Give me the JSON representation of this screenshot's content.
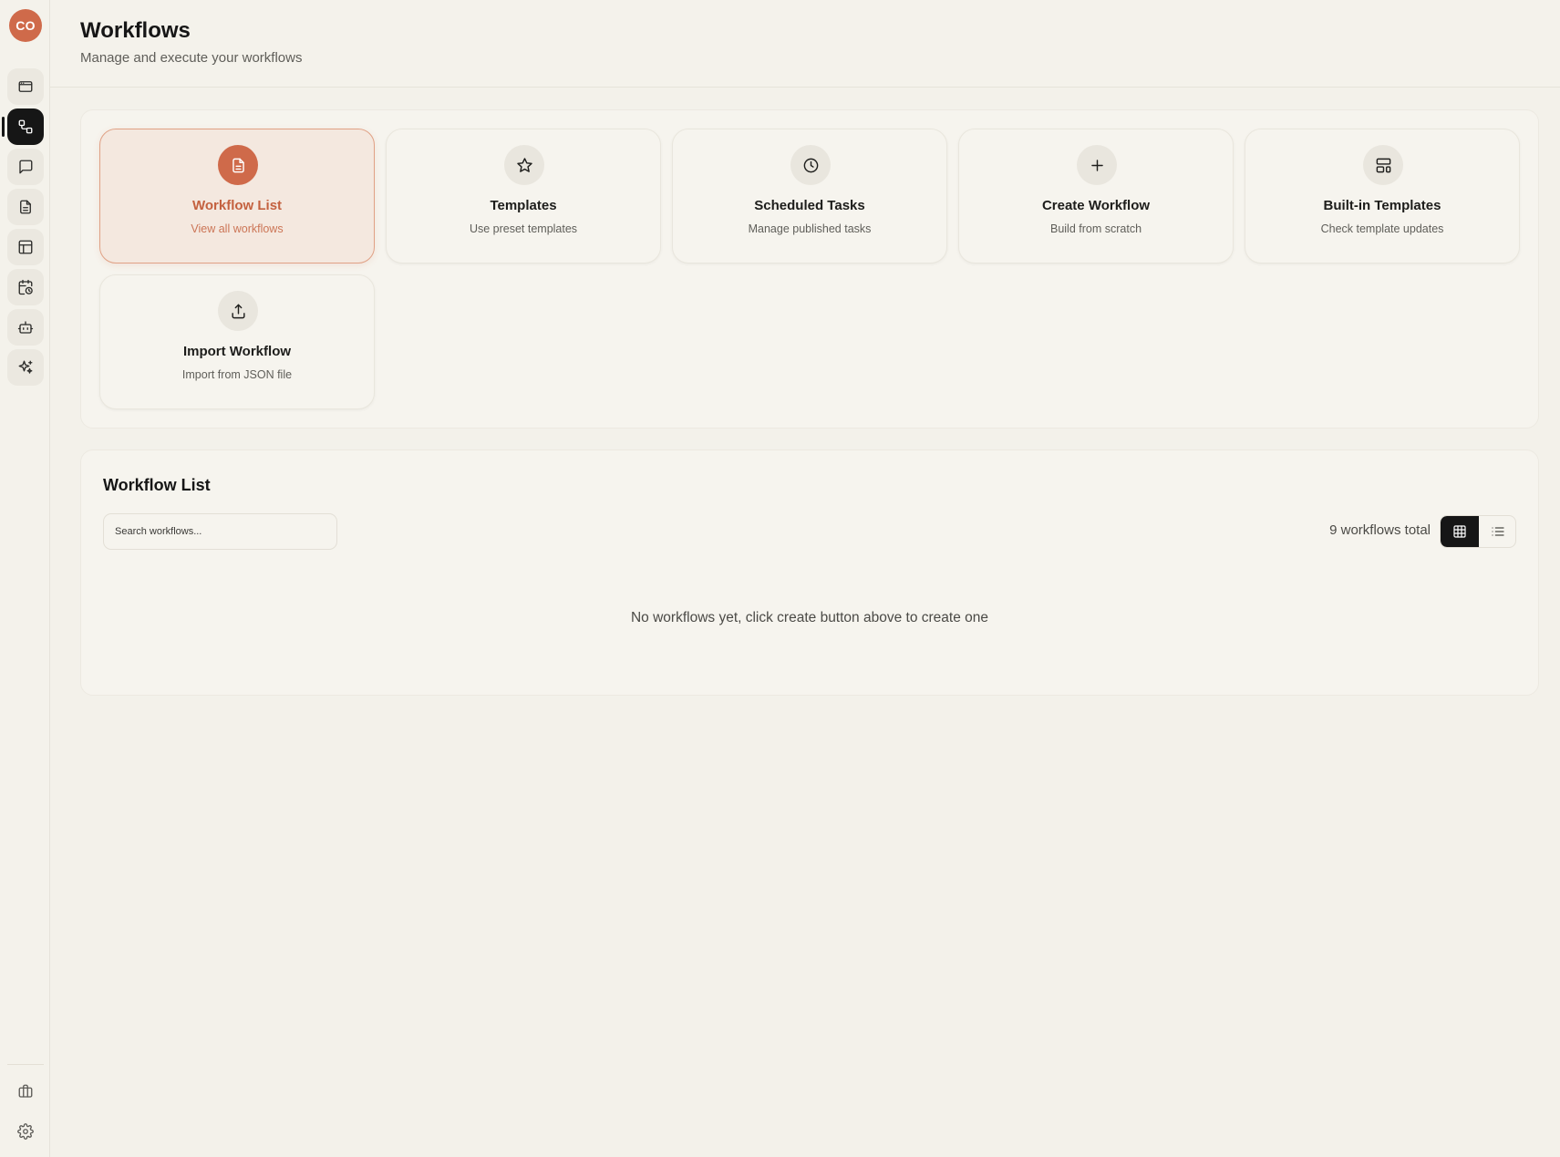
{
  "user": {
    "initials": "CO"
  },
  "sidebar": {
    "items": [
      {
        "icon": "browser-window-icon",
        "active": false
      },
      {
        "icon": "workflow-nodes-icon",
        "active": true
      },
      {
        "icon": "chat-bubble-icon",
        "active": false
      },
      {
        "icon": "document-icon",
        "active": false
      },
      {
        "icon": "table-layout-icon",
        "active": false
      },
      {
        "icon": "calendar-clock-icon",
        "active": false
      },
      {
        "icon": "robot-icon",
        "active": false
      },
      {
        "icon": "sparkles-icon",
        "active": false
      }
    ],
    "bottom": [
      {
        "icon": "briefcase-icon"
      },
      {
        "icon": "gear-icon"
      }
    ]
  },
  "header": {
    "title": "Workflows",
    "subtitle": "Manage and execute your workflows"
  },
  "actions": [
    {
      "title": "Workflow List",
      "description": "View all workflows",
      "icon": "document-icon",
      "selected": true
    },
    {
      "title": "Templates",
      "description": "Use preset templates",
      "icon": "star-icon",
      "selected": false
    },
    {
      "title": "Scheduled Tasks",
      "description": "Manage published tasks",
      "icon": "clock-icon",
      "selected": false
    },
    {
      "title": "Create Workflow",
      "description": "Build from scratch",
      "icon": "plus-icon",
      "selected": false
    },
    {
      "title": "Built-in Templates",
      "description": "Check template updates",
      "icon": "layout-template-icon",
      "selected": false
    },
    {
      "title": "Import Workflow",
      "description": "Import from JSON file",
      "icon": "upload-icon",
      "selected": false
    }
  ],
  "workflow_list": {
    "title": "Workflow List",
    "search_placeholder": "Search workflows...",
    "search_value": "",
    "total_label": "9 workflows total",
    "view_mode": "grid",
    "empty_message": "No workflows yet, click create button above to create one"
  },
  "colors": {
    "accent": "#cf6a4a",
    "background": "#f3f1ea",
    "active_nav": "#161616"
  }
}
